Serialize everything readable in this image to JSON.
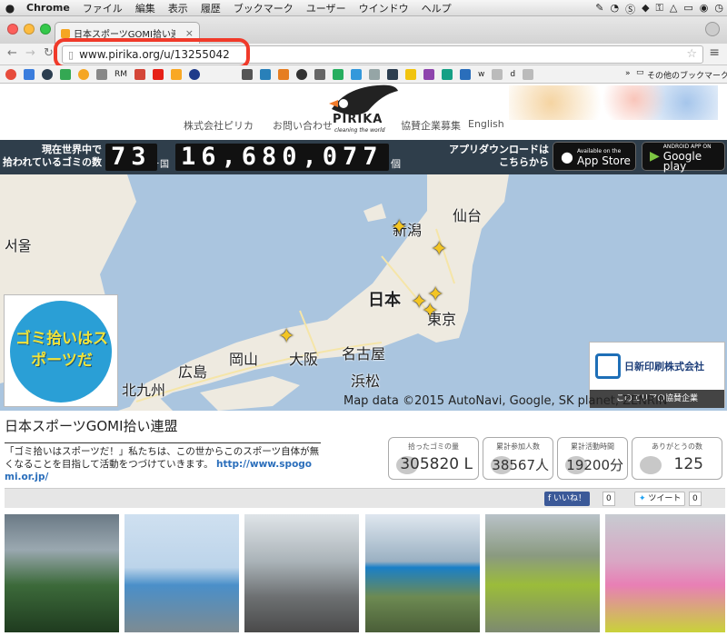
{
  "menubar": {
    "apple": "",
    "app": "Chrome",
    "items": [
      "ファイル",
      "編集",
      "表示",
      "履歴",
      "ブックマーク",
      "ユーザー",
      "ウインドウ",
      "ヘルプ"
    ]
  },
  "browser": {
    "tab_title": "日本スポーツGOMI拾い連盟",
    "url": "www.pirika.org/u/13255042",
    "bookmarks": [
      "RM",
      "w",
      "d"
    ],
    "other_bookmarks": "その他のブックマーク"
  },
  "site": {
    "logo": "PIRIKA",
    "logo_tagline": "cleaning the world",
    "nav": [
      "株式会社ピリカ",
      "お問い合わせ",
      "協賛企業募集",
      "English"
    ],
    "counter_label_1": "現在世界中で",
    "counter_label_2": "拾われているゴミの数",
    "countries": "73",
    "countries_unit": "ヶ国",
    "count": "16,680,077",
    "count_unit": "個",
    "app_label_1": "アプリダウンロードは",
    "app_label_2": "こちらから",
    "appstore_small": "Available on the",
    "appstore": "App Store",
    "gplay_small": "ANDROID APP ON",
    "gplay": "Google play"
  },
  "map": {
    "labels": [
      "서울",
      "新潟",
      "仙台",
      "日本",
      "東京",
      "大阪",
      "名古屋",
      "岡山",
      "広島",
      "北九州",
      "浜松"
    ],
    "logo_text": "ゴミ拾いはスポーツだ",
    "sponsor_name": "日新印刷株式会社",
    "sponsor_caption": "このエリアの協賛企業",
    "attribution": "Map data ©2015 AutoNavi, Google, SK planet, ZENRIN"
  },
  "group": {
    "title": "日本スポーツGOMI拾い連盟",
    "description": "「ゴミ拾いはスポーツだ！」私たちは、この世からこのスポーツ自体が無くなることを目指して活動をつづけていきます。",
    "link": "http://www.spogomi.or.jp/"
  },
  "stats": [
    {
      "label": "拾ったゴミの量",
      "value": "305820 L"
    },
    {
      "label": "累計参加人数",
      "value": "38567人"
    },
    {
      "label": "累計活動時間",
      "value": "19200分"
    },
    {
      "label": "ありがとうの数",
      "value": "125"
    }
  ],
  "social": {
    "like": "いいね！",
    "like_count": "0",
    "tweet": "ツイート",
    "tweet_count": "0"
  },
  "colors": {
    "accent": "#2f3e4b",
    "link": "#2a6ebb",
    "annotation": "#f03a2a"
  }
}
